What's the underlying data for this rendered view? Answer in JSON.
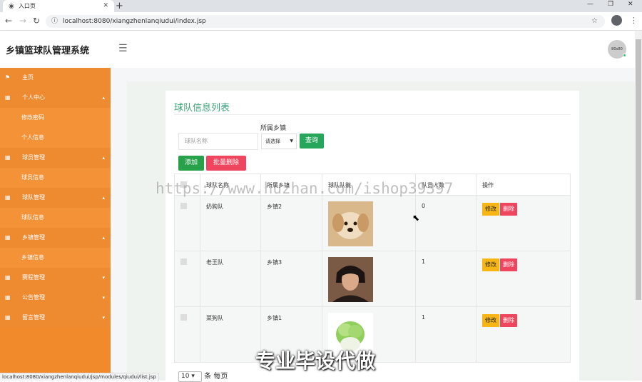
{
  "browser": {
    "tab_title": "入口页",
    "url": "localhost:8080/xiangzhenlanqiudui/index.jsp",
    "status_url": "localhost:8080/xiangzhenlanqiudui/jsp/modules/qiudui/list.jsp"
  },
  "header": {
    "app_title": "乡镇篮球队管理系统",
    "avatar_text": "80x80"
  },
  "sidebar": {
    "items": [
      {
        "label": "主页",
        "icon": "flag-icon"
      },
      {
        "label": "个人中心",
        "icon": "grid-icon"
      },
      {
        "label": "修改密码"
      },
      {
        "label": "个人信息"
      },
      {
        "label": "球员管理",
        "icon": "grid-icon"
      },
      {
        "label": "球员信息"
      },
      {
        "label": "球队管理",
        "icon": "grid-icon"
      },
      {
        "label": "球队信息"
      },
      {
        "label": "乡镇管理",
        "icon": "grid-icon"
      },
      {
        "label": "乡镇信息"
      },
      {
        "label": "赛程管理",
        "icon": "grid-icon"
      },
      {
        "label": "公告管理",
        "icon": "grid-icon"
      },
      {
        "label": "留言管理",
        "icon": "grid-icon"
      }
    ]
  },
  "main": {
    "title": "球队信息列表",
    "search": {
      "name_placeholder": "球队名称",
      "town_label": "所属乡镇",
      "town_select": "请选择",
      "search_button": "查询"
    },
    "actions": {
      "add": "添加",
      "batch_delete": "批量删除"
    },
    "table": {
      "headers": [
        "球队名称",
        "所属乡镇",
        "球队队徽",
        "队员人数",
        "操作"
      ],
      "rows": [
        {
          "name": "奶狗队",
          "town": "乡镇2",
          "emblem": "puppy",
          "count": "0"
        },
        {
          "name": "老王队",
          "town": "乡镇3",
          "emblem": "man-portrait",
          "count": "1"
        },
        {
          "name": "菜狗队",
          "town": "乡镇1",
          "emblem": "cabbage",
          "count": "1"
        }
      ],
      "edit_label": "修改",
      "delete_label": "删除"
    },
    "pager": {
      "page_size": "10",
      "suffix": "条 每页"
    }
  },
  "overlay": {
    "watermark": "https://www.huzhan.com/ishop39397",
    "caption": "专业毕设代做"
  },
  "colors": {
    "sidebar": "#f08a2b",
    "title": "#3ea37a",
    "search_button": "#26a65b",
    "delete": "#f0455e",
    "edit": "#f7b614"
  }
}
